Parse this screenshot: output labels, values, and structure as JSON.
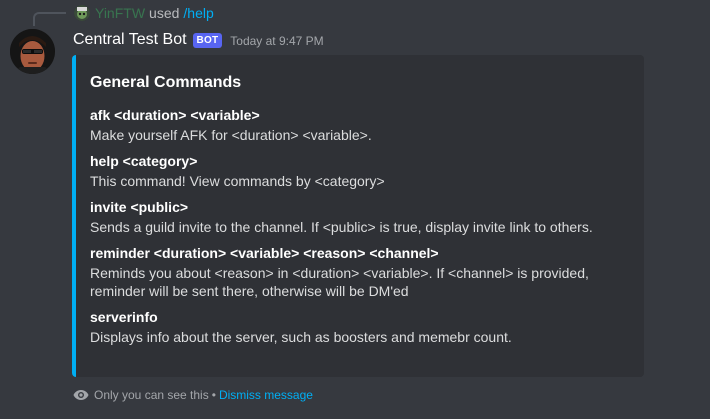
{
  "interaction": {
    "user": "YinFTW",
    "used_label": "used",
    "command": "/help"
  },
  "message": {
    "author": "Central Test Bot",
    "bot_tag": "BOT",
    "timestamp": "Today at 9:47 PM"
  },
  "embed": {
    "accent_color": "#00aff4",
    "title": "General Commands",
    "fields": [
      {
        "name": "afk <duration> <variable>",
        "value": "Make yourself AFK for <duration> <variable>."
      },
      {
        "name": "help <category>",
        "value": "This command! View commands by <category>"
      },
      {
        "name": "invite <public>",
        "value": "Sends a guild invite to the channel. If <public> is true, display invite link to others."
      },
      {
        "name": "reminder <duration> <variable> <reason> <channel>",
        "value": "Reminds you about <reason> in <duration> <variable>. If <channel> is provided, reminder will be sent there, otherwise will be DM'ed"
      },
      {
        "name": "serverinfo",
        "value": "Displays info about the server, such as boosters and memebr count."
      }
    ]
  },
  "ephemeral": {
    "icon": "eye-icon",
    "notice": "Only you can see this",
    "separator": "•",
    "dismiss_label": "Dismiss message"
  },
  "colors": {
    "background": "#36393f",
    "embed_background": "#2f3136",
    "link": "#00aff4",
    "bot_tag": "#5865f2"
  }
}
